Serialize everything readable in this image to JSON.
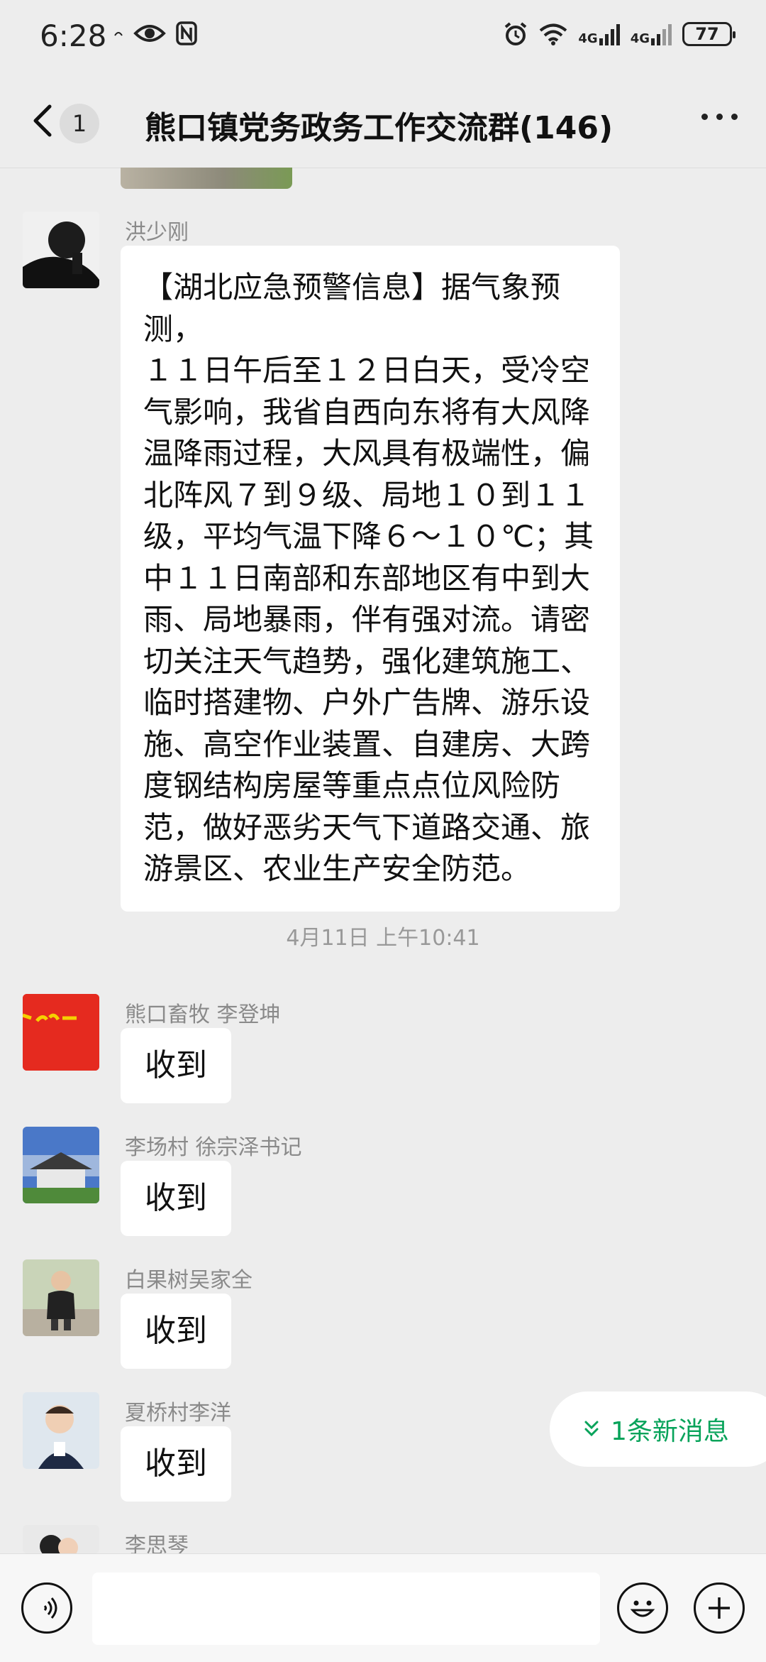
{
  "status_bar": {
    "time": "6:28",
    "network_1": "4G",
    "network_2": "4G",
    "battery": "77"
  },
  "header": {
    "unread_count": "1",
    "title": "熊口镇党务政务工作交流群(146)"
  },
  "messages": [
    {
      "sender": "洪少刚",
      "text": "【湖北应急预警信息】据气象预测，１１日午后至１２日白天，受冷空气影响，我省自西向东将有大风降温降雨过程，大风具有极端性，偏北阵风７到９级、局地１０到１１级，平均气温下降６～１０℃；其中１１日南部和东部地区有中到大雨、局地暴雨，伴有强对流。请密切关注天气趋势，强化建筑施工、临时搭建物、户外广告牌、游乐设施、高空作业装置、自建房、大跨度钢结构房屋等重点点位风险防范，做好恶劣天气下道路交通、旅游景区、农业生产安全防范。"
    },
    {
      "sender": "熊口畜牧 李登坤",
      "text": "收到"
    },
    {
      "sender": "李场村 徐宗泽书记",
      "text": "收到"
    },
    {
      "sender": "白果树吴家全",
      "text": "收到"
    },
    {
      "sender": "夏桥村李洋",
      "text": "收到"
    },
    {
      "sender": "李思琴"
    }
  ],
  "timestamp": "4月11日 上午10:41",
  "lines": [
    "【湖北应急预警信息】据气象预测，",
    "１１日午后至１２日白天，受冷空",
    "气影响，我省自西向东将有大风降",
    "温降雨过程，大风具有极端性，偏",
    "北阵风７到９级、局地１０到１１",
    "级，平均气温下降６～１０℃；其",
    "中１１日南部和东部地区有中到大",
    "雨、局地暴雨，伴有强对流。请密",
    "切关注天气趋势，强化建筑施工、",
    "临时搭建物、户外广告牌、游乐设",
    "施、高空作业装置、自建房、大跨",
    "度钢结构房屋等重点点位风险防",
    "范，做好恶劣天气下道路交通、旅",
    "游景区、农业生产安全防范。"
  ],
  "new_messages": "1条新消息",
  "colors": {
    "background": "#ededed",
    "bubble": "#ffffff",
    "accent_green": "#07a35a",
    "avatar_red": "#e52a1f"
  },
  "icons": [
    "back-icon",
    "more-icon",
    "voice-icon",
    "emoji-icon",
    "add-icon",
    "chevron-down-icon"
  ]
}
